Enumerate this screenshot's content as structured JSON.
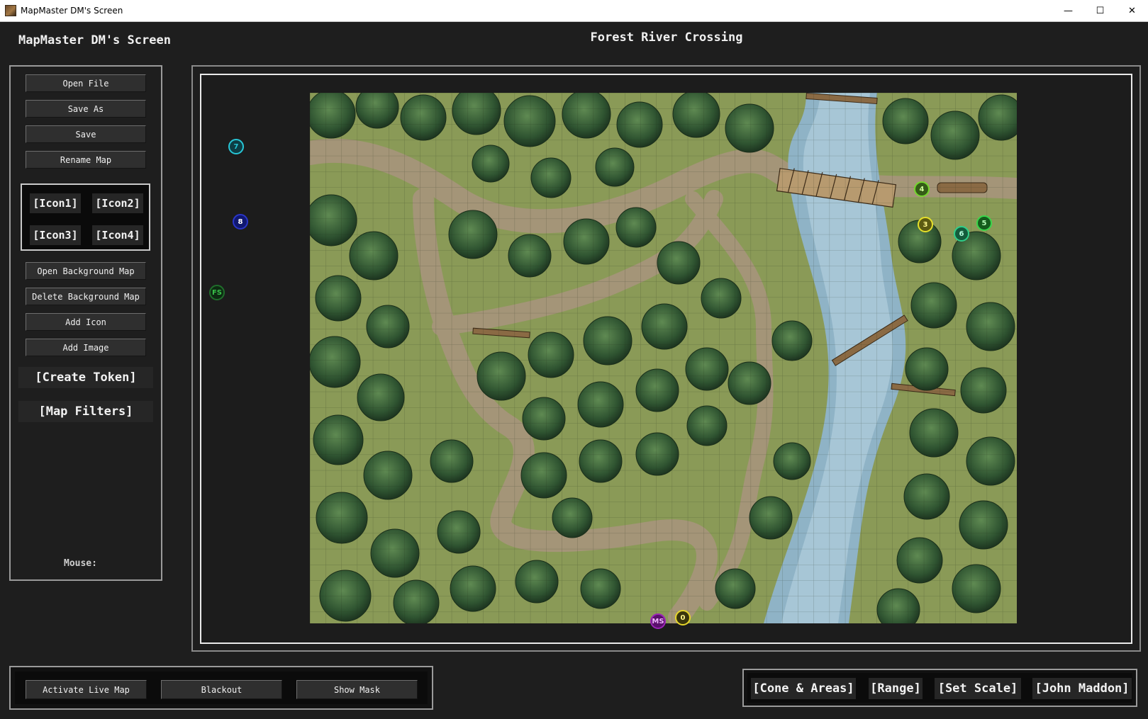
{
  "window": {
    "title": "MapMaster DM's Screen",
    "minimize": "—",
    "maximize": "☐",
    "close": "✕"
  },
  "app": {
    "title": "MapMaster DM's Screen"
  },
  "map": {
    "title": "Forest River Crossing"
  },
  "sidebar": {
    "buttons": [
      "Open File",
      "Save As",
      "Save",
      "Rename Map"
    ],
    "icons": [
      "[Icon1]",
      "[Icon2]",
      "[Icon3]",
      "[Icon4]"
    ],
    "buttons2": [
      "Open Background Map",
      "Delete Background Map",
      "Add Icon",
      "Add Image"
    ],
    "create_token": "[Create Token]",
    "map_filters": "[Map Filters]",
    "mouse_label": "Mouse:"
  },
  "tokens": [
    {
      "label": "7",
      "color": "#27c6d6"
    },
    {
      "label": "8",
      "color": "#2a35c8"
    },
    {
      "label": "FS",
      "color": "#1f6e2a"
    },
    {
      "label": "4",
      "color": "#74d62c"
    },
    {
      "label": "3",
      "color": "#e6e02a"
    },
    {
      "label": "6",
      "color": "#2fcf8a"
    },
    {
      "label": "5",
      "color": "#39d64a"
    },
    {
      "label": "MS",
      "color": "#9c24b8"
    },
    {
      "label": "0",
      "color": "#e6d62a"
    }
  ],
  "bottom_left": [
    "Activate Live Map",
    "Blackout",
    "Show Mask"
  ],
  "bottom_right": [
    "[Cone & Areas]",
    "[Range]",
    "[Set Scale]",
    "[John Maddon]"
  ]
}
